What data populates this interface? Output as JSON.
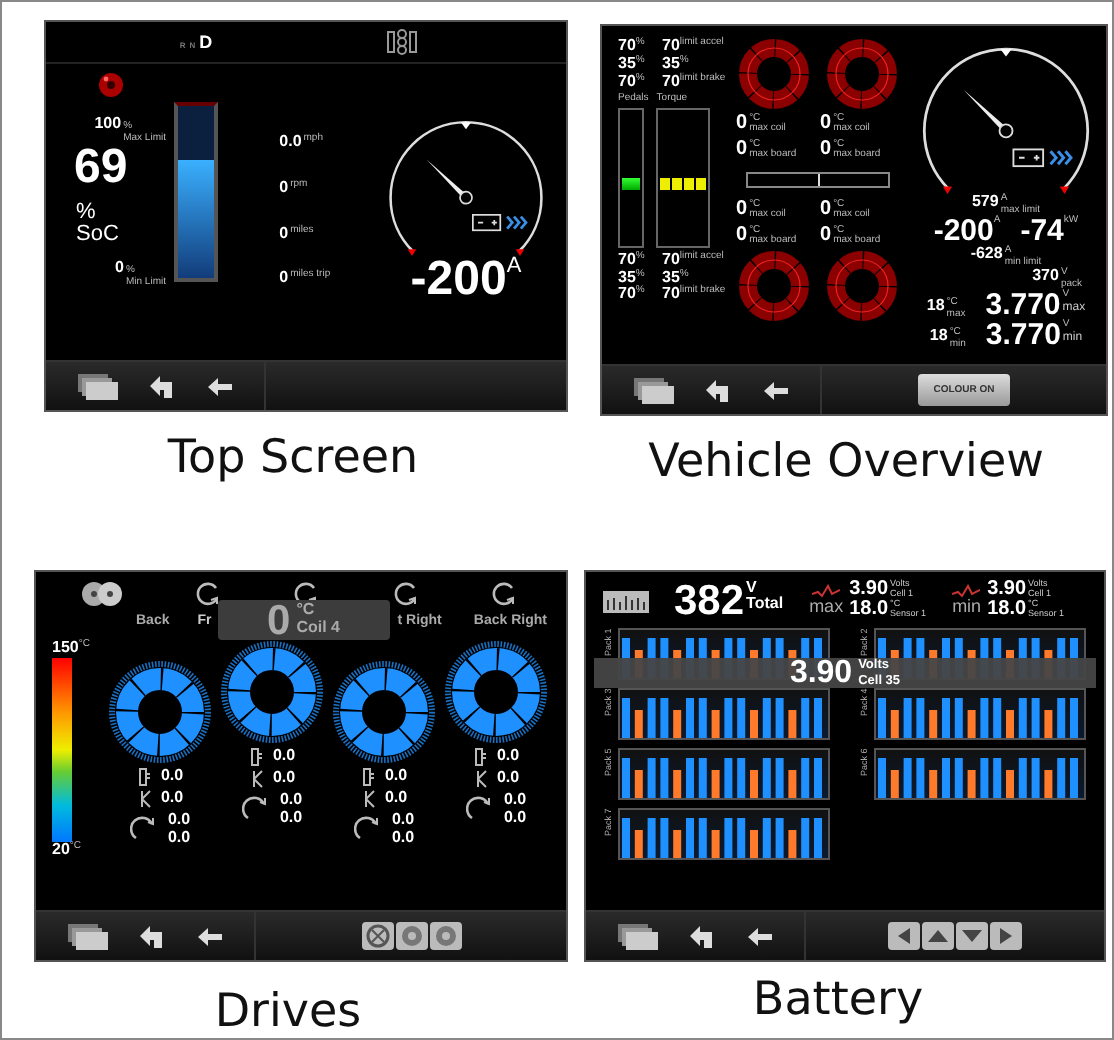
{
  "panels": [
    {
      "kind": "top_screen",
      "caption": "Top Screen",
      "gears": [
        {
          "label": "R",
          "selected": false
        },
        {
          "label": "N",
          "selected": false
        },
        {
          "label": "D",
          "selected": true
        }
      ],
      "soc": {
        "max": "100",
        "max_unit": "%",
        "max_label": "Max Limit",
        "value": "69",
        "unit": "%",
        "label": "SoC",
        "min": "0",
        "min_unit": "%",
        "min_label": "Min Limit",
        "level": 0.69
      },
      "readings": [
        {
          "value": "0.0",
          "unit": "mph"
        },
        {
          "value": "0",
          "unit": "rpm"
        },
        {
          "value": "0",
          "unit": "miles"
        },
        {
          "value": "0",
          "unit": "miles trip"
        }
      ],
      "gauge": {
        "level": 0.33,
        "value": "-200",
        "unit": "A"
      }
    },
    {
      "kind": "vehicle_overview",
      "caption": "Vehicle Overview",
      "limits_top": [
        {
          "value": "70",
          "unit": "%",
          "limit": "70",
          "limit_unit": "limit accel"
        },
        {
          "value": "35",
          "unit": "%",
          "limit": "35",
          "limit_unit": "%"
        },
        {
          "value": "70",
          "unit": "%",
          "limit": "70",
          "limit_unit": "limit brake"
        }
      ],
      "pedals": {
        "label": "Pedals",
        "level": 0.45
      },
      "torque": {
        "label": "Torque",
        "level": 0.45
      },
      "temps_top": [
        {
          "value": "0",
          "unit": "°C",
          "label": "max coil"
        },
        {
          "value": "0",
          "unit": "°C",
          "label": "max coil"
        },
        {
          "value": "0",
          "unit": "°C",
          "label": "max board"
        },
        {
          "value": "0",
          "unit": "°C",
          "label": "max board"
        }
      ],
      "balance": {
        "level": 0.5
      },
      "temps_bottom": [
        {
          "value": "0",
          "unit": "°C",
          "label": "max coil"
        },
        {
          "value": "0",
          "unit": "°C",
          "label": "max coil"
        },
        {
          "value": "0",
          "unit": "°C",
          "label": "max board"
        },
        {
          "value": "0",
          "unit": "°C",
          "label": "max board"
        }
      ],
      "limits_bottom": [
        {
          "value": "70",
          "unit": "%",
          "limit": "70",
          "limit_unit": "limit accel"
        },
        {
          "value": "35",
          "unit": "%",
          "limit": "35",
          "limit_unit": "%"
        },
        {
          "value": "70",
          "unit": "%",
          "limit": "70",
          "limit_unit": "limit brake"
        }
      ],
      "gauge": {
        "level": 0.33
      },
      "current": {
        "max": "579",
        "max_unit": "A",
        "max_label": "max limit",
        "value": "-200",
        "unit": "A",
        "power": "-74",
        "power_unit": "kW",
        "min": "-628",
        "min_unit": "A",
        "min_label": "min limit"
      },
      "pack": {
        "value": "370",
        "unit": "V",
        "label": "pack"
      },
      "cells": [
        {
          "temp": "18",
          "temp_unit": "°C",
          "temp_label": "max",
          "volts": "3.770",
          "volts_unit": "V",
          "volts_label": "max"
        },
        {
          "temp": "18",
          "temp_unit": "°C",
          "temp_label": "min",
          "volts": "3.770",
          "volts_unit": "V",
          "volts_label": "min"
        }
      ],
      "button": "COLOUR ON"
    },
    {
      "kind": "drives",
      "caption": "Drives",
      "wheel_labels": [
        "Back",
        "Fr",
        "t Right",
        "Back Right"
      ],
      "popup": {
        "value": "0",
        "unit": "°C",
        "label": "Coil 4"
      },
      "scale": {
        "max": "150",
        "max_unit": "°C",
        "min": "20",
        "min_unit": "°C"
      },
      "wheels": [
        {
          "temp_a": "0.0",
          "temp_b": "0.0",
          "speed_a": "0.0",
          "speed_b": "0.0"
        },
        {
          "temp_a": "0.0",
          "temp_b": "0.0",
          "speed_a": "0.0",
          "speed_b": "0.0"
        },
        {
          "temp_a": "0.0",
          "temp_b": "0.0",
          "speed_a": "0.0",
          "speed_b": "0.0"
        },
        {
          "temp_a": "0.0",
          "temp_b": "0.0",
          "speed_a": "0.0",
          "speed_b": "0.0"
        }
      ]
    },
    {
      "kind": "battery",
      "caption": "Battery",
      "total": {
        "value": "382",
        "unit": "V",
        "label": "Total"
      },
      "extremes": [
        {
          "label": "max",
          "volts": "3.90",
          "volts_unit": "Volts",
          "cell": "Cell 1",
          "temp": "18.0",
          "temp_unit": "°C",
          "sensor": "Sensor 1"
        },
        {
          "label": "min",
          "volts": "3.90",
          "volts_unit": "Volts",
          "cell": "Cell 1",
          "temp": "18.0",
          "temp_unit": "°C",
          "sensor": "Sensor 1"
        }
      ],
      "packs": [
        {
          "label": "Pack 1"
        },
        {
          "label": "Pack 2"
        },
        {
          "label": "Pack 3"
        },
        {
          "label": "Pack 4"
        },
        {
          "label": "Pack 5"
        },
        {
          "label": "Pack 6"
        },
        {
          "label": "Pack 7"
        }
      ],
      "popup": {
        "value": "3.90",
        "unit": "Volts",
        "label": "Cell 35"
      }
    }
  ]
}
